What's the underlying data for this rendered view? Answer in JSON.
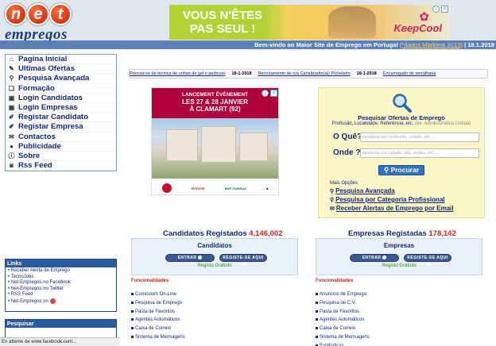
{
  "logo": {
    "net_letters": [
      "n",
      "e",
      "t"
    ],
    "wordmark": "empregos"
  },
  "ad_top": {
    "headline_line1": "VOUS N'ÊTES",
    "headline_line2": "PAS SEUL !",
    "brand": "KeepCool",
    "close": "✕",
    "info": "i"
  },
  "header_bar": {
    "welcome": "Bem-vindo ao Maior Site de Emprego em Portugal",
    "note": "(*dados Marktest 2013)",
    "date": "18.1.2018"
  },
  "nav": [
    {
      "label": "Pagina Inicial",
      "icon": "home-icon",
      "glyph": "⌂"
    },
    {
      "label": "Ultimas Ofertas",
      "icon": "pencil-icon",
      "glyph": "✎"
    },
    {
      "label": "Pesquisa Avançada",
      "icon": "search-icon",
      "glyph": "⚲"
    },
    {
      "label": "Formação",
      "icon": "book-icon",
      "glyph": "❏"
    },
    {
      "label": "Login Candidatos",
      "icon": "lock-icon",
      "glyph": "▣"
    },
    {
      "label": "Login Empresas",
      "icon": "lock-icon",
      "glyph": "▣"
    },
    {
      "label": "Registar Candidato",
      "icon": "edit-icon",
      "glyph": "✐"
    },
    {
      "label": "Registar Empresa",
      "icon": "edit-icon",
      "glyph": "✐"
    },
    {
      "label": "Contactos",
      "icon": "mail-icon",
      "glyph": "✉"
    },
    {
      "label": "Publicidade",
      "icon": "globe-icon",
      "glyph": "●"
    },
    {
      "label": "Sobre",
      "icon": "info-icon",
      "glyph": "ⓘ"
    },
    {
      "label": "Rss Feed",
      "icon": "rss-icon",
      "glyph": "◙"
    }
  ],
  "links_box": {
    "title": "Links",
    "items": [
      "Receber Alerta de Emprego",
      "TecnoJobs",
      "Net-Empregos no Facebook",
      "Net-Empregos no Twitter",
      "RSS Feed",
      "Net-Empregos  on"
    ]
  },
  "pesquisar_box": {
    "title": "Pesquisar"
  },
  "statusbar": "En attente de www.facebook.com...",
  "ticker": [
    {
      "text": "Precisa-se de tecnica de unhas de gel e pedicure",
      "date": "18-1-2018"
    },
    {
      "text": "Recrutamento de o/a Canalizador(a)/ Picheleiro",
      "date": "18-1-2018"
    },
    {
      "text": "Encarregado de serralharia",
      "date": ""
    }
  ],
  "ad_mid": {
    "line1": "LANCEMENT ÉVÉNEMENT",
    "line2": "LES 27 & 28 JANVIER",
    "line3": "À CLAMART (92)",
    "logos": [
      "",
      "EIFFAGE",
      "BNP PARIBAS",
      "■"
    ]
  },
  "search": {
    "title": "Pesquisar Ofertas de Emprego",
    "subtitle": "Profissão, Localidade, Referência, etc.",
    "example": "(ex: Administrativa Lisboa)",
    "q_label": "O Quê?",
    "q_placeholder": "pesquisa por profissão, cidade, etc. ...",
    "where_label": "Onde ?",
    "where_placeholder": "pesquisa por cidade, vila, região, etc. ...",
    "button": "Procurar",
    "options_title": "Mais Opções",
    "options": [
      "Pesquisa Avançada",
      "Pesquisa por Categoria Profissional",
      "Receber Alertas de Emprego por Email"
    ]
  },
  "candidatos": {
    "heading": "Candidatos Registados",
    "count": "4,146,002",
    "panel_title": "Candidatos",
    "btn_enter": "ENTRAR",
    "btn_register": "REGISTE-SE AQUI",
    "free": "Registo Gratuito",
    "func_title": "Funcionalidades",
    "funcs": [
      "Curriculum On-Line",
      "Pesquisa de Emprego",
      "Pasta de Favoritos",
      "Agentes Automáticos",
      "Caixa de Correio",
      "Sistema de Mensagens"
    ]
  },
  "empresas": {
    "heading": "Empresas Registadas",
    "count": "178,142",
    "panel_title": "Empresas",
    "btn_enter": "ENTRAR",
    "btn_register": "REGISTE-SE AQUI",
    "free": "Registo Gratuito",
    "func_title": "Funcionalidades",
    "funcs": [
      "Anúncios de Emprego",
      "Pesquisa de C.V.",
      "Pasta de Favoritos",
      "Agentes Automáticos",
      "Caixa de Correio",
      "Sistema de Mensagens",
      "Estatísticas"
    ]
  }
}
